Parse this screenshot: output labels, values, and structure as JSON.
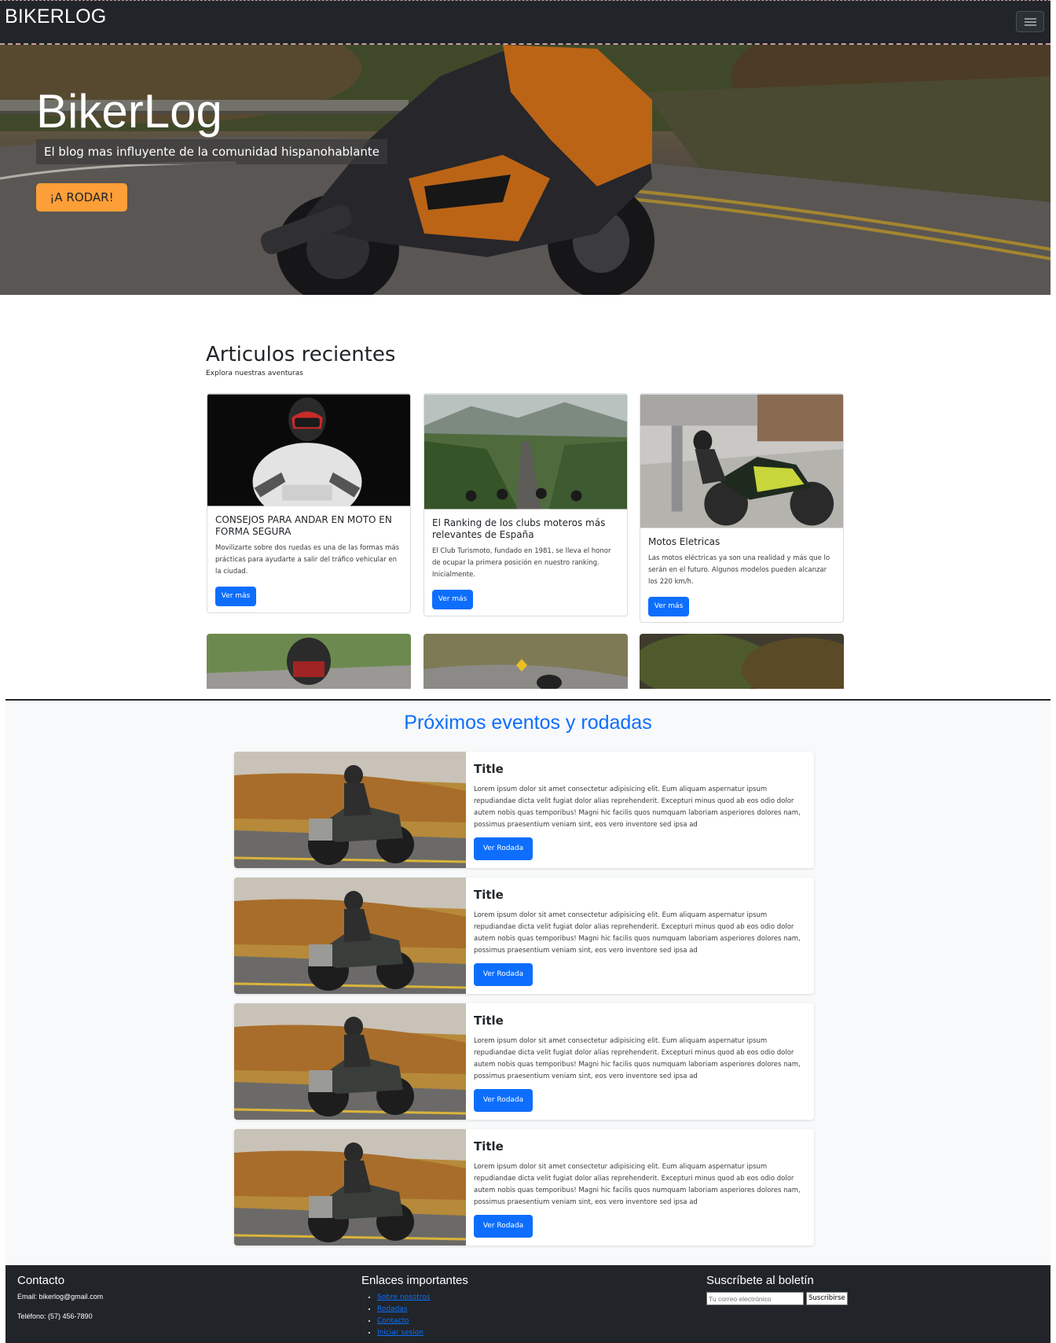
{
  "nav": {
    "brand": "BIKERLOG",
    "toggle_icon": "hamburger-icon"
  },
  "hero": {
    "title": "BikerLog",
    "subtitle": "El blog mas influyente de la comunidad hispanohablante",
    "cta": "¡A RODAR!",
    "accent": "#fd9f38"
  },
  "recent": {
    "title": "Articulos recientes",
    "tagline": "Explora nuestras aventuras",
    "cards": [
      {
        "title": "CONSEJOS PARA ANDAR EN MOTO EN FORMA SEGURA",
        "text": "Movilizarte sobre dos ruedas es una de las formas más prácticas para ayudarte a salir del tráfico vehicular en la ciudad.",
        "button": "Ver más"
      },
      {
        "title": "El Ranking de los clubs moteros más relevantes de España",
        "text": "El Club Turismoto, fundado en 1981, se lleva el honor de ocupar la primera posición en nuestro ranking. Inicialmente.",
        "button": "Ver más"
      },
      {
        "title": "Motos Eletricas",
        "text": "Las motos eléctricas ya son una realidad y más que lo serán en el futuro. Algunos modelos pueden alcanzar los 220 km/h.",
        "button": "Ver más"
      }
    ]
  },
  "events": {
    "title": "Próximos eventos y rodadas",
    "items": [
      {
        "title": "Title",
        "text": "Lorem ipsum dolor sit amet consectetur adipisicing elit. Eum aliquam aspernatur ipsum repudiandae dicta velit fugiat dolor alias reprehenderit. Excepturi minus quod ab eos odio dolor autem nobis quas temporibus! Magni hic facilis quos numquam laboriam asperiores dolores nam, possimus praesentium veniam sint, eos vero inventore sed ipsa ad",
        "button": "Ver Rodada"
      },
      {
        "title": "Title",
        "text": "Lorem ipsum dolor sit amet consectetur adipisicing elit. Eum aliquam aspernatur ipsum repudiandae dicta velit fugiat dolor alias reprehenderit. Excepturi minus quod ab eos odio dolor autem nobis quas temporibus! Magni hic facilis quos numquam laboriam asperiores dolores nam, possimus praesentium veniam sint, eos vero inventore sed ipsa ad",
        "button": "Ver Rodada"
      },
      {
        "title": "Title",
        "text": "Lorem ipsum dolor sit amet consectetur adipisicing elit. Eum aliquam aspernatur ipsum repudiandae dicta velit fugiat dolor alias reprehenderit. Excepturi minus quod ab eos odio dolor autem nobis quas temporibus! Magni hic facilis quos numquam laboriam asperiores dolores nam, possimus praesentium veniam sint, eos vero inventore sed ipsa ad",
        "button": "Ver Rodada"
      },
      {
        "title": "Title",
        "text": "Lorem ipsum dolor sit amet consectetur adipisicing elit. Eum aliquam aspernatur ipsum repudiandae dicta velit fugiat dolor alias reprehenderit. Excepturi minus quod ab eos odio dolor autem nobis quas temporibus! Magni hic facilis quos numquam laboriam asperiores dolores nam, possimus praesentium veniam sint, eos vero inventore sed ipsa ad",
        "button": "Ver Rodada"
      }
    ]
  },
  "footer": {
    "contact": {
      "title": "Contacto",
      "email": "Email: bikerlog@gmail.com",
      "phone": "Teléfono: (57) 456-7890"
    },
    "links": {
      "title": "Enlaces importantes",
      "items": [
        "Sobre nosotros",
        "Rodadas",
        "Contacto",
        "Iniciar sesion"
      ]
    },
    "newsletter": {
      "title": "Suscríbete al boletín",
      "placeholder": "Tu correo electrónico",
      "button": "Suscribirse"
    }
  },
  "colors": {
    "primary": "#0d6efd",
    "dark": "#212529",
    "accent": "#fd9f38"
  }
}
